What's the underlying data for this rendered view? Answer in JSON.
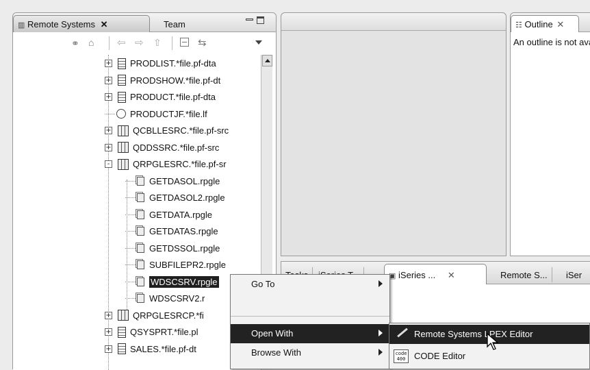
{
  "remote_systems": {
    "tab_label": "Remote Systems",
    "team_tab_label": "Team",
    "tree_items": [
      {
        "label": "PRODLIST.*file.pf-dta",
        "icon": "physical-file-icon",
        "expander": "+"
      },
      {
        "label": "PRODSHOW.*file.pf-dt",
        "icon": "physical-file-icon",
        "expander": "+"
      },
      {
        "label": "PRODUCT.*file.pf-dta",
        "icon": "physical-file-icon",
        "expander": "+"
      },
      {
        "label": "PRODUCTJF.*file.lf",
        "icon": "logical-file-icon",
        "expander": ""
      },
      {
        "label": "QCBLLESRC.*file.pf-src",
        "icon": "source-file-icon",
        "expander": "+"
      },
      {
        "label": "QDDSSRC.*file.pf-src",
        "icon": "source-file-icon",
        "expander": "+"
      },
      {
        "label": "QRPGLESRC.*file.pf-sr",
        "icon": "source-file-icon",
        "expander": "-"
      },
      {
        "label": "GETDASOL.rpgle",
        "icon": "member-icon",
        "expander": ""
      },
      {
        "label": "GETDASOL2.rpgle",
        "icon": "member-icon",
        "expander": ""
      },
      {
        "label": "GETDATA.rpgle",
        "icon": "member-icon",
        "expander": ""
      },
      {
        "label": "GETDATAS.rpgle",
        "icon": "member-icon",
        "expander": ""
      },
      {
        "label": "GETDSSOL.rpgle",
        "icon": "member-icon",
        "expander": ""
      },
      {
        "label": "SUBFILEPR2.rpgle",
        "icon": "member-icon",
        "expander": ""
      },
      {
        "label": "WDSCSRV.rpgle",
        "icon": "member-icon",
        "expander": ""
      },
      {
        "label": "WDSCSRV2.r",
        "icon": "member-icon",
        "expander": ""
      },
      {
        "label": "QRPGLESRCP.*fi",
        "icon": "source-file-icon",
        "expander": "+"
      },
      {
        "label": "QSYSPRT.*file.pl",
        "icon": "physical-file-icon",
        "expander": "+"
      },
      {
        "label": "SALES.*file.pf-dt",
        "icon": "physical-file-icon",
        "expander": "+"
      }
    ]
  },
  "outline": {
    "tab_label": "Outline",
    "message": "An outline is not available."
  },
  "bottom_tabs": {
    "tasks": "Tasks",
    "iseries_t": "iSeries T...",
    "iseries_active": "iSeries ...",
    "remote_s": "Remote S...",
    "iser": "iSer"
  },
  "context_menu": {
    "items": [
      {
        "label": "Go To",
        "submenu": true
      },
      {
        "label": "Open With",
        "submenu": true
      },
      {
        "label": "Browse With",
        "submenu": true
      }
    ]
  },
  "submenu": {
    "items": [
      {
        "label": "Remote Systems LPEX Editor",
        "icon": "pencil-icon"
      },
      {
        "label": "CODE Editor",
        "icon": "code-400-icon",
        "icon_text_top": "code",
        "icon_text_bottom": "400"
      }
    ]
  },
  "colors": {
    "selection": "#1f1f1f",
    "tab_bg": "#dcdcdc"
  }
}
